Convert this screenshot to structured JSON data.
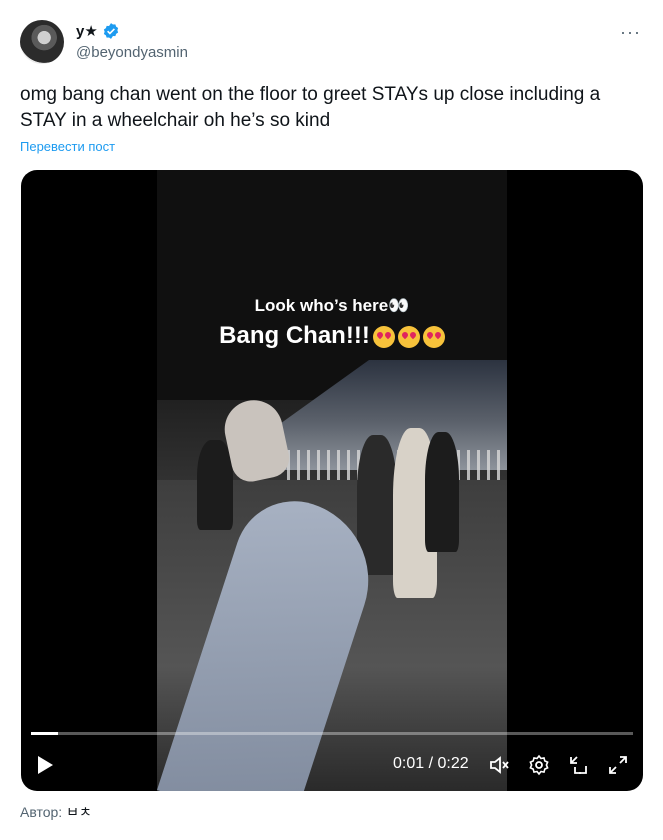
{
  "user": {
    "display_name": "y★",
    "handle": "@beyondyasmin",
    "more_label": "···"
  },
  "tweet": {
    "text": "omg bang chan went on the floor to greet STAYs up close including a STAY in a wheelchair oh he’s so kind",
    "translate_label": "Перевести пост"
  },
  "video": {
    "overlay_line1": "Look who’s here👀",
    "overlay_line2": "Bang Chan!!!",
    "current_time": "0:01",
    "separator": "/",
    "duration": "0:22",
    "progress": 0.045,
    "icons": [
      "play-icon",
      "mute-icon",
      "settings-icon",
      "minimize-icon",
      "fullscreen-icon"
    ]
  },
  "footer": {
    "author_label": "Автор:",
    "author_name": "ㅂㅊ"
  },
  "colors": {
    "accent": "#1d9bf0",
    "secondary_text": "#536471",
    "text": "#0f1419"
  }
}
